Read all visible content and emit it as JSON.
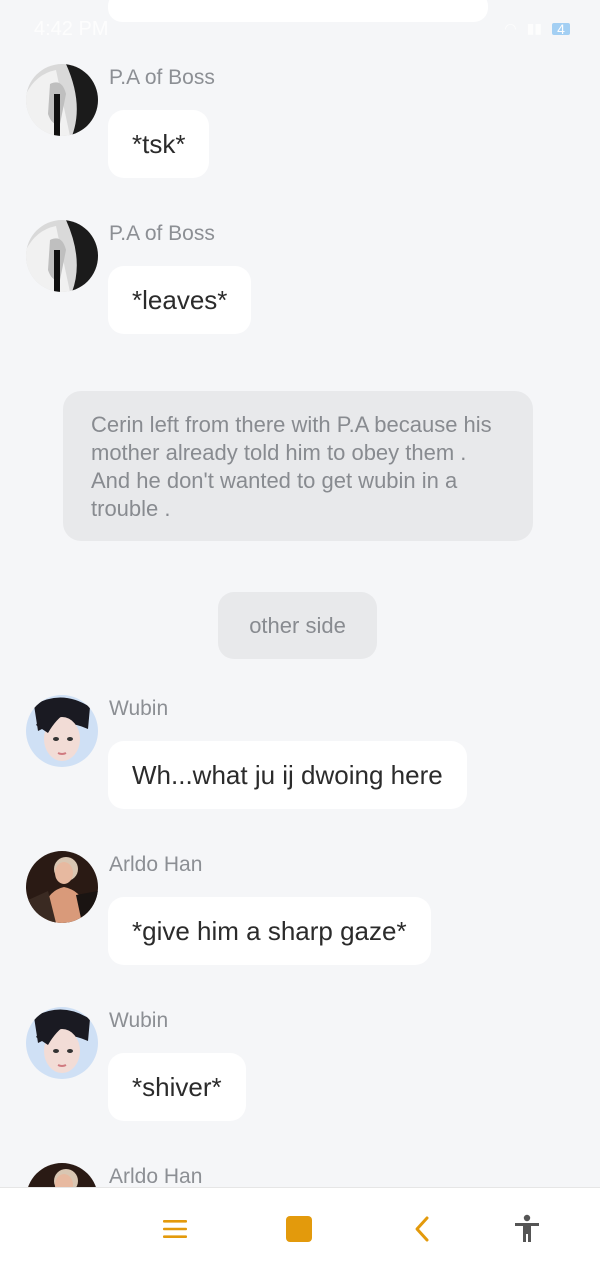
{
  "status_bar": {
    "time": "4:42 PM",
    "battery": "4"
  },
  "messages": [
    {
      "sender": "P.A of Boss",
      "text": "*tsk*",
      "avatar": "pa-avatar"
    },
    {
      "sender": "P.A of Boss",
      "text": "*leaves*",
      "avatar": "pa-avatar"
    },
    {
      "sender": "Wubin",
      "text": "Wh...what ju ij dwoing here",
      "avatar": "wubin-avatar"
    },
    {
      "sender": "Arldo Han",
      "text": "*give him a sharp gaze*",
      "avatar": "arldo-avatar"
    },
    {
      "sender": "Wubin",
      "text": "*shiver*",
      "avatar": "wubin-avatar"
    },
    {
      "sender": "Arldo Han",
      "text": "",
      "avatar": "arldo-avatar"
    }
  ],
  "narration": "Cerin left from there with P.A because his mother already told him to obey them . And he don't wanted to get wubin in a trouble .",
  "scene_tag": "other side",
  "bottom_nav": {
    "icons": [
      "menu-icon",
      "home-square-icon",
      "back-chevron-icon",
      "accessibility-icon"
    ],
    "accent": "#e39a0c"
  }
}
